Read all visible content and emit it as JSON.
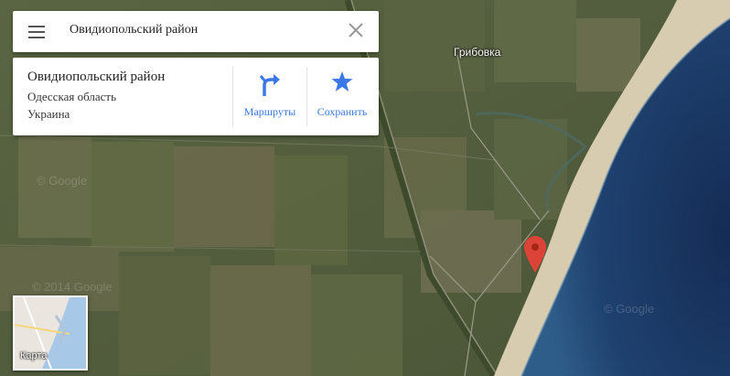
{
  "search": {
    "query": "Овидиопольский район"
  },
  "place_card": {
    "title": "Овидиопольский район",
    "region": "Одесская область",
    "country": "Украина",
    "actions": {
      "directions": "Маршруты",
      "save": "Сохранить"
    }
  },
  "map": {
    "settlement_label": "Грибовка",
    "minimap_label": "Карта",
    "watermarks": [
      "© Google",
      "© 2014 Google",
      "© Google"
    ]
  },
  "colors": {
    "accent": "#3b78e7",
    "pin": "#db4437",
    "sea": "#1f3f6b",
    "beach": "#d8ccb0"
  },
  "icons": [
    "menu-icon",
    "close-icon",
    "directions-icon",
    "star-icon",
    "map-pin-icon"
  ]
}
